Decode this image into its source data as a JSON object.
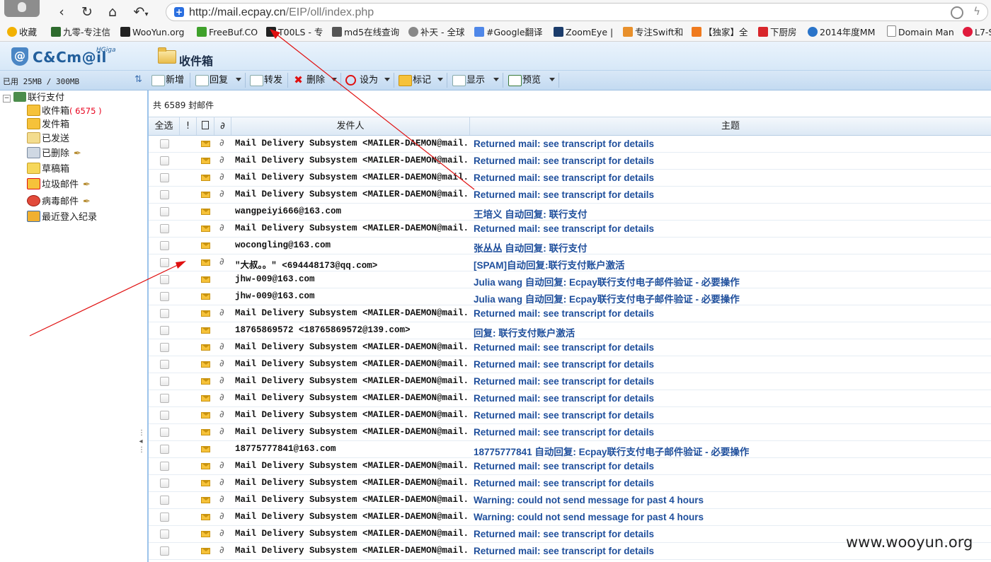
{
  "browser": {
    "url_host": "http://mail.ecpay.cn",
    "url_path": "/EIP/oll/index.php",
    "bookmarks": [
      "收藏",
      "九零-专注信",
      "WooYun.org",
      "FreeBuf.CO",
      "T00LS - 专",
      "md5在线查询",
      "补天 - 全球",
      "#Google翻译",
      "ZoomEye |",
      "专注Swift和",
      "【独家】全",
      "下厨房",
      "2014年度MM",
      "Domain Man",
      "L7-S"
    ]
  },
  "app": {
    "logo": "C&Cm@il",
    "logo_sup": "HGiga",
    "page_title": "收件箱"
  },
  "toolbar": {
    "quota": "已用 25MB / 300MB",
    "buttons": [
      "新增",
      "回复",
      "转发",
      "删除",
      "设为",
      "标记",
      "显示",
      "预览"
    ]
  },
  "sidebar": {
    "root": "联行支付",
    "root_toggle": "⊟",
    "folders": [
      {
        "label": "收件箱",
        "count": "( 6575 )"
      },
      {
        "label": "发件箱",
        "count": ""
      },
      {
        "label": "已发送",
        "count": ""
      },
      {
        "label": "已删除",
        "count": ""
      },
      {
        "label": "草稿箱",
        "count": ""
      },
      {
        "label": "垃圾邮件",
        "count": ""
      },
      {
        "label": "病毒邮件",
        "count": ""
      },
      {
        "label": "最近登入纪录",
        "count": ""
      }
    ]
  },
  "list": {
    "total": "共 6589 封邮件",
    "headers": {
      "select_all": "全选",
      "priority": "!",
      "sender": "发件人",
      "subject": "主题"
    },
    "rows": [
      {
        "sender": "Mail Delivery Subsystem <MAILER-DAEMON@mail.e…",
        "subject": "Returned mail: see transcript for details",
        "attach": true
      },
      {
        "sender": "Mail Delivery Subsystem <MAILER-DAEMON@mail.e…",
        "subject": "Returned mail: see transcript for details",
        "attach": true
      },
      {
        "sender": "Mail Delivery Subsystem <MAILER-DAEMON@mail.e…",
        "subject": "Returned mail: see transcript for details",
        "attach": true
      },
      {
        "sender": "Mail Delivery Subsystem <MAILER-DAEMON@mail.e…",
        "subject": "Returned mail: see transcript for details",
        "attach": true
      },
      {
        "sender": "wangpeiyi666@163.com",
        "subject": "王培义 自动回复: 联行支付",
        "attach": false
      },
      {
        "sender": "Mail Delivery Subsystem <MAILER-DAEMON@mail.e…",
        "subject": "Returned mail: see transcript for details",
        "attach": true
      },
      {
        "sender": "wocongling@163.com",
        "subject": "张丛丛 自动回复: 联行支付",
        "attach": false
      },
      {
        "sender": "\"大叔。。\" <694448173@qq.com>",
        "subject": "[SPAM]自动回复:联行支付账户激活",
        "attach": true
      },
      {
        "sender": "jhw-009@163.com",
        "subject": "Julia wang 自动回复: Ecpay联行支付电子邮件验证 - 必要操作",
        "attach": false
      },
      {
        "sender": "jhw-009@163.com",
        "subject": "Julia wang 自动回复: Ecpay联行支付电子邮件验证 - 必要操作",
        "attach": false
      },
      {
        "sender": "Mail Delivery Subsystem <MAILER-DAEMON@mail.e…",
        "subject": "Returned mail: see transcript for details",
        "attach": true
      },
      {
        "sender": "18765869572 <18765869572@139.com>",
        "subject": "回复: 联行支付账户激活",
        "attach": false
      },
      {
        "sender": "Mail Delivery Subsystem <MAILER-DAEMON@mail.e…",
        "subject": "Returned mail: see transcript for details",
        "attach": true
      },
      {
        "sender": "Mail Delivery Subsystem <MAILER-DAEMON@mail.e…",
        "subject": "Returned mail: see transcript for details",
        "attach": true
      },
      {
        "sender": "Mail Delivery Subsystem <MAILER-DAEMON@mail.e…",
        "subject": "Returned mail: see transcript for details",
        "attach": true
      },
      {
        "sender": "Mail Delivery Subsystem <MAILER-DAEMON@mail.e…",
        "subject": "Returned mail: see transcript for details",
        "attach": true
      },
      {
        "sender": "Mail Delivery Subsystem <MAILER-DAEMON@mail.e…",
        "subject": "Returned mail: see transcript for details",
        "attach": true
      },
      {
        "sender": "Mail Delivery Subsystem <MAILER-DAEMON@mail.e…",
        "subject": "Returned mail: see transcript for details",
        "attach": true
      },
      {
        "sender": "18775777841@163.com",
        "subject": "18775777841 自动回复: Ecpay联行支付电子邮件验证 - 必要操作",
        "attach": false
      },
      {
        "sender": "Mail Delivery Subsystem <MAILER-DAEMON@mail.e…",
        "subject": "Returned mail: see transcript for details",
        "attach": true
      },
      {
        "sender": "Mail Delivery Subsystem <MAILER-DAEMON@mail.e…",
        "subject": "Returned mail: see transcript for details",
        "attach": true
      },
      {
        "sender": "Mail Delivery Subsystem <MAILER-DAEMON@mail.e…",
        "subject": "Warning: could not send message for past 4 hours",
        "attach": true
      },
      {
        "sender": "Mail Delivery Subsystem <MAILER-DAEMON@mail.e…",
        "subject": "Warning: could not send message for past 4 hours",
        "attach": true
      },
      {
        "sender": "Mail Delivery Subsystem <MAILER-DAEMON@mail.e…",
        "subject": "Returned mail: see transcript for details",
        "attach": true
      },
      {
        "sender": "Mail Delivery Subsystem <MAILER-DAEMON@mail.e…",
        "subject": "Returned mail: see transcript for details",
        "attach": true
      }
    ]
  },
  "watermark": "www.wooyun.org",
  "colors": {
    "subject": "#1f4f9c",
    "count": "#e8001c",
    "annotation": "#e01010"
  }
}
